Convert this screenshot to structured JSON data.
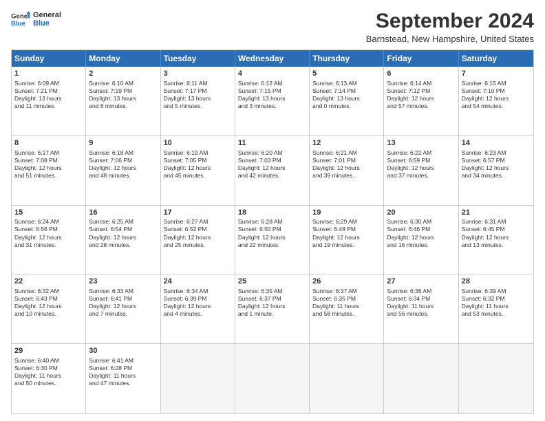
{
  "logo": {
    "line1": "General",
    "line2": "Blue"
  },
  "title": "September 2024",
  "location": "Barnstead, New Hampshire, United States",
  "days_of_week": [
    "Sunday",
    "Monday",
    "Tuesday",
    "Wednesday",
    "Thursday",
    "Friday",
    "Saturday"
  ],
  "weeks": [
    [
      {
        "day": "1",
        "info": "Sunrise: 6:09 AM\nSunset: 7:21 PM\nDaylight: 13 hours\nand 11 minutes."
      },
      {
        "day": "2",
        "info": "Sunrise: 6:10 AM\nSunset: 7:19 PM\nDaylight: 13 hours\nand 8 minutes."
      },
      {
        "day": "3",
        "info": "Sunrise: 6:11 AM\nSunset: 7:17 PM\nDaylight: 13 hours\nand 5 minutes."
      },
      {
        "day": "4",
        "info": "Sunrise: 6:12 AM\nSunset: 7:15 PM\nDaylight: 13 hours\nand 3 minutes."
      },
      {
        "day": "5",
        "info": "Sunrise: 6:13 AM\nSunset: 7:14 PM\nDaylight: 13 hours\nand 0 minutes."
      },
      {
        "day": "6",
        "info": "Sunrise: 6:14 AM\nSunset: 7:12 PM\nDaylight: 12 hours\nand 57 minutes."
      },
      {
        "day": "7",
        "info": "Sunrise: 6:15 AM\nSunset: 7:10 PM\nDaylight: 12 hours\nand 54 minutes."
      }
    ],
    [
      {
        "day": "8",
        "info": "Sunrise: 6:17 AM\nSunset: 7:08 PM\nDaylight: 12 hours\nand 51 minutes."
      },
      {
        "day": "9",
        "info": "Sunrise: 6:18 AM\nSunset: 7:06 PM\nDaylight: 12 hours\nand 48 minutes."
      },
      {
        "day": "10",
        "info": "Sunrise: 6:19 AM\nSunset: 7:05 PM\nDaylight: 12 hours\nand 45 minutes."
      },
      {
        "day": "11",
        "info": "Sunrise: 6:20 AM\nSunset: 7:03 PM\nDaylight: 12 hours\nand 42 minutes."
      },
      {
        "day": "12",
        "info": "Sunrise: 6:21 AM\nSunset: 7:01 PM\nDaylight: 12 hours\nand 39 minutes."
      },
      {
        "day": "13",
        "info": "Sunrise: 6:22 AM\nSunset: 6:59 PM\nDaylight: 12 hours\nand 37 minutes."
      },
      {
        "day": "14",
        "info": "Sunrise: 6:23 AM\nSunset: 6:57 PM\nDaylight: 12 hours\nand 34 minutes."
      }
    ],
    [
      {
        "day": "15",
        "info": "Sunrise: 6:24 AM\nSunset: 6:56 PM\nDaylight: 12 hours\nand 31 minutes."
      },
      {
        "day": "16",
        "info": "Sunrise: 6:25 AM\nSunset: 6:54 PM\nDaylight: 12 hours\nand 28 minutes."
      },
      {
        "day": "17",
        "info": "Sunrise: 6:27 AM\nSunset: 6:52 PM\nDaylight: 12 hours\nand 25 minutes."
      },
      {
        "day": "18",
        "info": "Sunrise: 6:28 AM\nSunset: 6:50 PM\nDaylight: 12 hours\nand 22 minutes."
      },
      {
        "day": "19",
        "info": "Sunrise: 6:29 AM\nSunset: 6:48 PM\nDaylight: 12 hours\nand 19 minutes."
      },
      {
        "day": "20",
        "info": "Sunrise: 6:30 AM\nSunset: 6:46 PM\nDaylight: 12 hours\nand 16 minutes."
      },
      {
        "day": "21",
        "info": "Sunrise: 6:31 AM\nSunset: 6:45 PM\nDaylight: 12 hours\nand 13 minutes."
      }
    ],
    [
      {
        "day": "22",
        "info": "Sunrise: 6:32 AM\nSunset: 6:43 PM\nDaylight: 12 hours\nand 10 minutes."
      },
      {
        "day": "23",
        "info": "Sunrise: 6:33 AM\nSunset: 6:41 PM\nDaylight: 12 hours\nand 7 minutes."
      },
      {
        "day": "24",
        "info": "Sunrise: 6:34 AM\nSunset: 6:39 PM\nDaylight: 12 hours\nand 4 minutes."
      },
      {
        "day": "25",
        "info": "Sunrise: 6:35 AM\nSunset: 6:37 PM\nDaylight: 12 hours\nand 1 minute."
      },
      {
        "day": "26",
        "info": "Sunrise: 6:37 AM\nSunset: 6:35 PM\nDaylight: 11 hours\nand 58 minutes."
      },
      {
        "day": "27",
        "info": "Sunrise: 6:38 AM\nSunset: 6:34 PM\nDaylight: 11 hours\nand 56 minutes."
      },
      {
        "day": "28",
        "info": "Sunrise: 6:39 AM\nSunset: 6:32 PM\nDaylight: 11 hours\nand 53 minutes."
      }
    ],
    [
      {
        "day": "29",
        "info": "Sunrise: 6:40 AM\nSunset: 6:30 PM\nDaylight: 11 hours\nand 50 minutes."
      },
      {
        "day": "30",
        "info": "Sunrise: 6:41 AM\nSunset: 6:28 PM\nDaylight: 11 hours\nand 47 minutes."
      },
      {
        "day": "",
        "info": ""
      },
      {
        "day": "",
        "info": ""
      },
      {
        "day": "",
        "info": ""
      },
      {
        "day": "",
        "info": ""
      },
      {
        "day": "",
        "info": ""
      }
    ]
  ]
}
